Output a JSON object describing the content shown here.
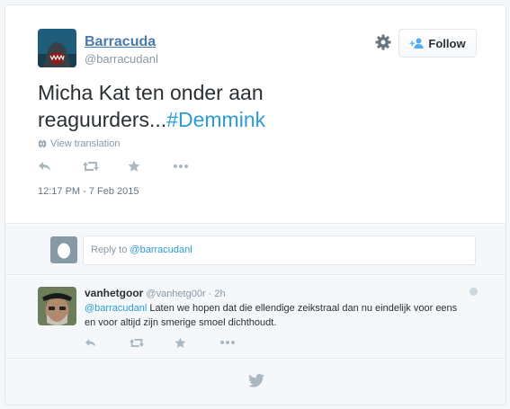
{
  "tweet": {
    "author_name": "Barracuda",
    "author_handle": "@barracudanl",
    "follow_label": "Follow",
    "text_main": "Micha Kat ten onder aan reaguurders...",
    "text_hashtag": "#Demmink",
    "view_translation": "View translation",
    "timestamp": "12:17 PM - 7 Feb 2015",
    "actions": [
      "reply-icon",
      "retweet-icon",
      "favorite-icon",
      "more-icon"
    ]
  },
  "reply_box": {
    "prefix": "Reply to ",
    "mention": "@barracudanl"
  },
  "reply": {
    "name": "vanhetgoor",
    "handle": "@vanhetg00r",
    "separator": " · ",
    "time": "2h",
    "mention": "@barracudanl",
    "text": " Laten we hopen dat die ellendige zeikstraal dan nu eindelijk voor eens en voor altijd zijn smerige smoel dichthoudt."
  },
  "colors": {
    "link": "#2b9bd5",
    "name": "#4a7aab",
    "muted": "#8899a6",
    "icon": "#aab8c2"
  }
}
